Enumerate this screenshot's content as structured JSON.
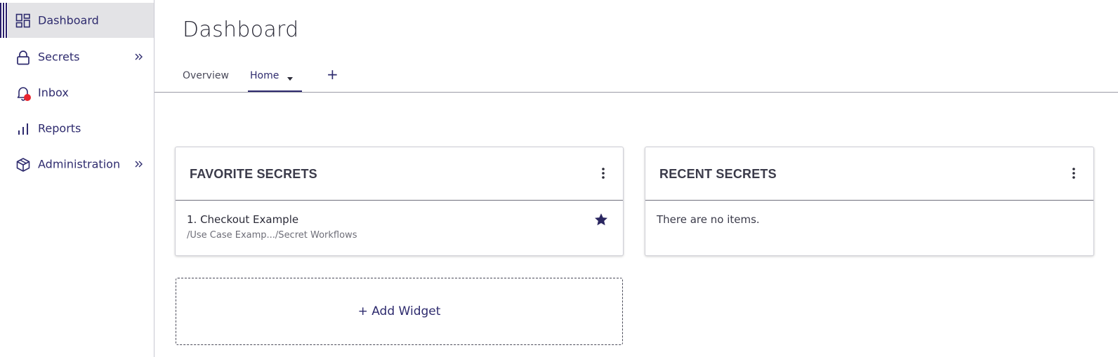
{
  "sidebar": {
    "items": [
      {
        "label": "Dashboard",
        "icon": "dashboard-icon",
        "active": true
      },
      {
        "label": "Secrets",
        "icon": "lock-icon",
        "expandable": true
      },
      {
        "label": "Inbox",
        "icon": "bell-icon",
        "notification": true
      },
      {
        "label": "Reports",
        "icon": "bar-chart-icon"
      },
      {
        "label": "Administration",
        "icon": "box-icon",
        "expandable": true
      }
    ]
  },
  "header": {
    "title": "Dashboard"
  },
  "tabs": {
    "items": [
      {
        "label": "Overview",
        "active": false
      },
      {
        "label": "Home",
        "active": true
      }
    ],
    "add_label": "+"
  },
  "widgets": {
    "favorites": {
      "title": "FAVORITE SECRETS",
      "items": [
        {
          "title": "1. Checkout Example",
          "path": "/Use Case Examp.../Secret Workflows",
          "favorited": true
        }
      ]
    },
    "recent": {
      "title": "RECENT SECRETS",
      "empty_text": "There are no items."
    },
    "add_widget_label": "+ Add Widget"
  },
  "colors": {
    "accent": "#2e2b6e",
    "active_bg": "#e3e3e6",
    "notification": "#e8252f"
  }
}
